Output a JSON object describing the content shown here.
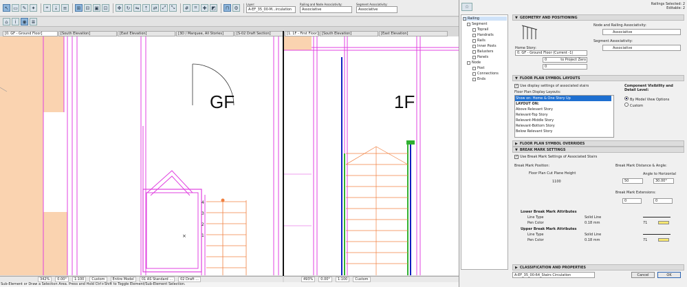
{
  "toolbar": {
    "layer_label": "Layer:",
    "layer_value": "A-EF_35_00-M...irculation",
    "rna_label": "Railing and Node Associativity:",
    "rna_value": "Associative",
    "seg_label": "Segment Associativity:",
    "seg_value": "Associative"
  },
  "tabs": [
    "[0. GF - Ground Floor]",
    "[South Elevation]",
    "[East Elevation]",
    "[3D / Marquee, All Stories]",
    "[S-02 Draft Section]",
    "[1. 1F - First Floor]",
    "[South Elevation]",
    "[East Elevation]"
  ],
  "plan": {
    "gf_label": "GF",
    "f1_label": "1F",
    "stair_numbers": [
      "4",
      "3",
      "2",
      "1"
    ]
  },
  "statusbar_left": {
    "zoom": "342%",
    "angle": "0.00°",
    "scale": "1:100",
    "custom": "Custom",
    "model": "Entire Model",
    "standard": "01 AS Standard ...",
    "draft": "02 Draft ..."
  },
  "statusbar_right": {
    "zoom": "493%",
    "angle": "0.00°",
    "scale": "1:100",
    "custom": "Custom"
  },
  "status_message": "Sub-Element or Draw a Selection Area. Press and Hold Ctrl+Shift to Toggle Element/Sub-Element Selection.",
  "dialog": {
    "header_line1": "Railings Selected: 2",
    "header_line2": "Editable: 2",
    "tree": {
      "root": "Railing",
      "segment": "Segment",
      "toprail": "Toprail",
      "handrails": "Handrails",
      "rails": "Rails",
      "inner_posts": "Inner Posts",
      "balusters": "Balusters",
      "panels": "Panels",
      "node": "Node",
      "post": "Post",
      "connections": "Connections",
      "ends": "Ends"
    },
    "geometry": {
      "title": "GEOMETRY AND POSITIONING",
      "node_assoc_label": "Node and Railing Associativity:",
      "node_assoc_value": "Associative",
      "seg_assoc_label": "Segment Associativity:",
      "seg_assoc_value": "Associative",
      "home_story_label": "Home Story:",
      "home_story_value": "0. GF - Ground Floor (Current -1)",
      "offset1": "0",
      "to_project_zero": "to Project Zero",
      "offset2": "0"
    },
    "fps": {
      "title": "FLOOR PLAN SYMBOL LAYOUTS",
      "use_display": "Use display settings of associated stairs",
      "layouts_label": "Floor Plan Display Layouts:",
      "layouts": [
        "Show on: Home & One Story Up",
        "LAYOUT ON:",
        "Above Relevant Story",
        "Relevant-Top Story",
        "Relevant-Middle Story",
        "Relevant-Bottom Story",
        "Below Relevant Story"
      ],
      "comp_vis_label": "Component Visibility and Detail Level:",
      "opt_model": "By Model View Options",
      "opt_custom": "Custom"
    },
    "overrides_title": "FLOOR PLAN SYMBOL OVERRIDES",
    "break": {
      "title": "BREAK MARK SETTINGS",
      "use_settings": "Use Break Mark Settings of Associated Stairs",
      "position_label": "Break Mark Position:",
      "cut_plane_label": "Floor Plan Cut Plane Height",
      "cut_plane_value": "1100",
      "distance_label": "Break Mark Distance & Angle:",
      "distance_value": "50",
      "angle_label": "Angle to Horizontal",
      "angle_value": "30.00°",
      "extensions_label": "Break Mark Extensions:",
      "ext1": "0",
      "ext2": "0"
    },
    "lower": {
      "title": "Lower Break Mark Attributes",
      "line_type_label": "Line Type",
      "line_type_value": "Solid Line",
      "pen_color_label": "Pen Color",
      "pen_size": "0.18 mm",
      "pen_number": "71"
    },
    "upper": {
      "title": "Upper Break Mark Attributes",
      "line_type_label": "Line Type",
      "line_type_value": "Solid Line",
      "pen_color_label": "Pen Color",
      "pen_size": "0.18 mm",
      "pen_number": "71"
    },
    "classification_title": "CLASSIFICATION AND PROPERTIES",
    "bottom_layer": "A-EF_35_00-64_Stairs Circulation",
    "cancel": "Cancel",
    "ok": "OK"
  },
  "colors": {
    "magenta": "#e040e0",
    "orange": "#f08040",
    "blue": "#1020c0",
    "green": "#30b030",
    "fill": "#fad3b0",
    "selection": "#1e6fd0",
    "pen_yellow": "#f7e770"
  }
}
